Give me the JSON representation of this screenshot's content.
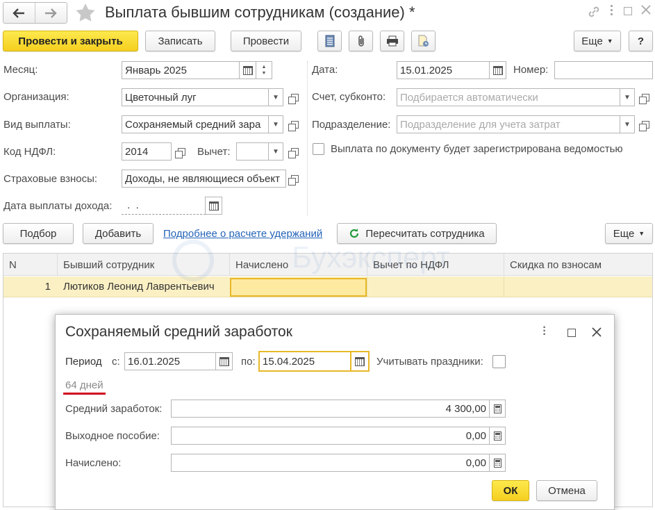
{
  "window": {
    "title": "Выплата бывшим сотрудникам (создание) *"
  },
  "toolbar": {
    "post_close": "Провести и закрыть",
    "save": "Записать",
    "post": "Провести",
    "more": "Еще",
    "help": "?"
  },
  "form": {
    "month_label": "Месяц:",
    "month_value": "Январь 2025",
    "org_label": "Организация:",
    "org_value": "Цветочный луг",
    "pay_type_label": "Вид выплаты:",
    "pay_type_value": "Сохраняемый средний зара",
    "ndfl_code_label": "Код НДФЛ:",
    "ndfl_code_value": "2014",
    "deduction_label": "Вычет:",
    "deduction_value": "",
    "insurance_label": "Страховые взносы:",
    "insurance_value": "Доходы, не являющиеся объект",
    "pay_date_label": "Дата выплаты дохода:",
    "pay_date_value": " .  .",
    "date_label": "Дата:",
    "date_value": "15.01.2025",
    "number_label": "Номер:",
    "number_value": "",
    "account_label": "Счет, субконто:",
    "account_placeholder": "Подбирается автоматически",
    "division_label": "Подразделение:",
    "division_placeholder": "Подразделение для учета затрат",
    "statement_checkbox_label": "Выплата по документу будет зарегистрирована ведомостью"
  },
  "table_toolbar": {
    "select": "Подбор",
    "add": "Добавить",
    "details_link": "Подробнее о расчете удержаний",
    "recalc": "Пересчитать сотрудника",
    "more": "Еще"
  },
  "table": {
    "columns": [
      "N",
      "Бывший сотрудник",
      "Начислено",
      "Вычет по НДФЛ",
      "Скидка по взносам"
    ],
    "rows": [
      {
        "n": "1",
        "employee": "Лютиков Леонид Лаврентьевич",
        "accrued": "",
        "deduction": "",
        "discount": ""
      }
    ]
  },
  "watermark": "Бухэксперт",
  "dialog": {
    "title": "Сохраняемый средний заработок",
    "period_label": "Период",
    "from_label": "с:",
    "from_value": "16.01.2025",
    "to_label": "по:",
    "to_value": "15.04.2025",
    "holidays_label": "Учитывать праздники:",
    "days_text": "64 дней",
    "avg_label": "Средний заработок:",
    "avg_value": "4 300,00",
    "severance_label": "Выходное пособие:",
    "severance_value": "0,00",
    "accrued_label": "Начислено:",
    "accrued_value": "0,00",
    "ok": "ОК",
    "cancel": "Отмена"
  },
  "colors": {
    "accent_yellow": "#f5cf1f",
    "focus_border": "#e8b828",
    "row_highlight": "#fbf0c4",
    "link_blue": "#2363b8",
    "underline_red": "#d0021b"
  }
}
